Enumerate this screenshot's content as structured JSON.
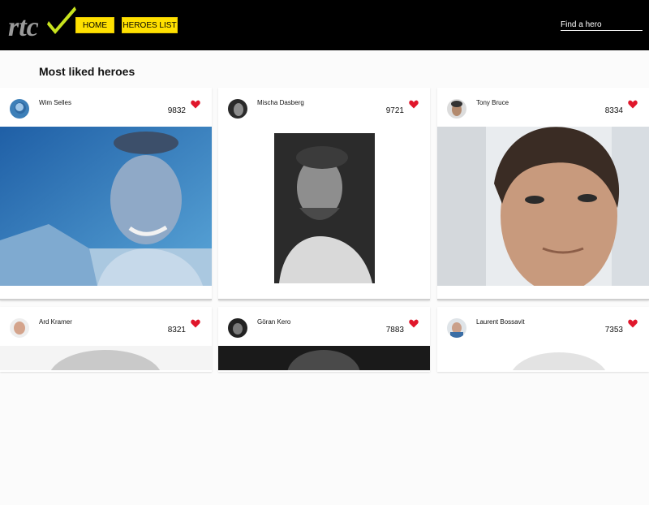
{
  "header": {
    "logo_text": "rtc",
    "nav": [
      {
        "label": "HOME"
      },
      {
        "label": "HEROES LIST"
      }
    ],
    "search": {
      "placeholder": "Find a hero",
      "value": ""
    }
  },
  "page_title": "Most liked heroes",
  "colors": {
    "accent_yellow": "#ffe000",
    "heart_red": "#e0162b",
    "topbar": "#000000",
    "logo_check": "#c8e31e"
  },
  "heroes": [
    {
      "name": "Wim Selles",
      "likes": "9832"
    },
    {
      "name": "Mischa Dasberg",
      "likes": "9721"
    },
    {
      "name": "Tony Bruce",
      "likes": "8334"
    },
    {
      "name": "Ard Kramer",
      "likes": "8321"
    },
    {
      "name": "Göran Kero",
      "likes": "7883"
    },
    {
      "name": "Laurent Bossavit",
      "likes": "7353"
    }
  ]
}
